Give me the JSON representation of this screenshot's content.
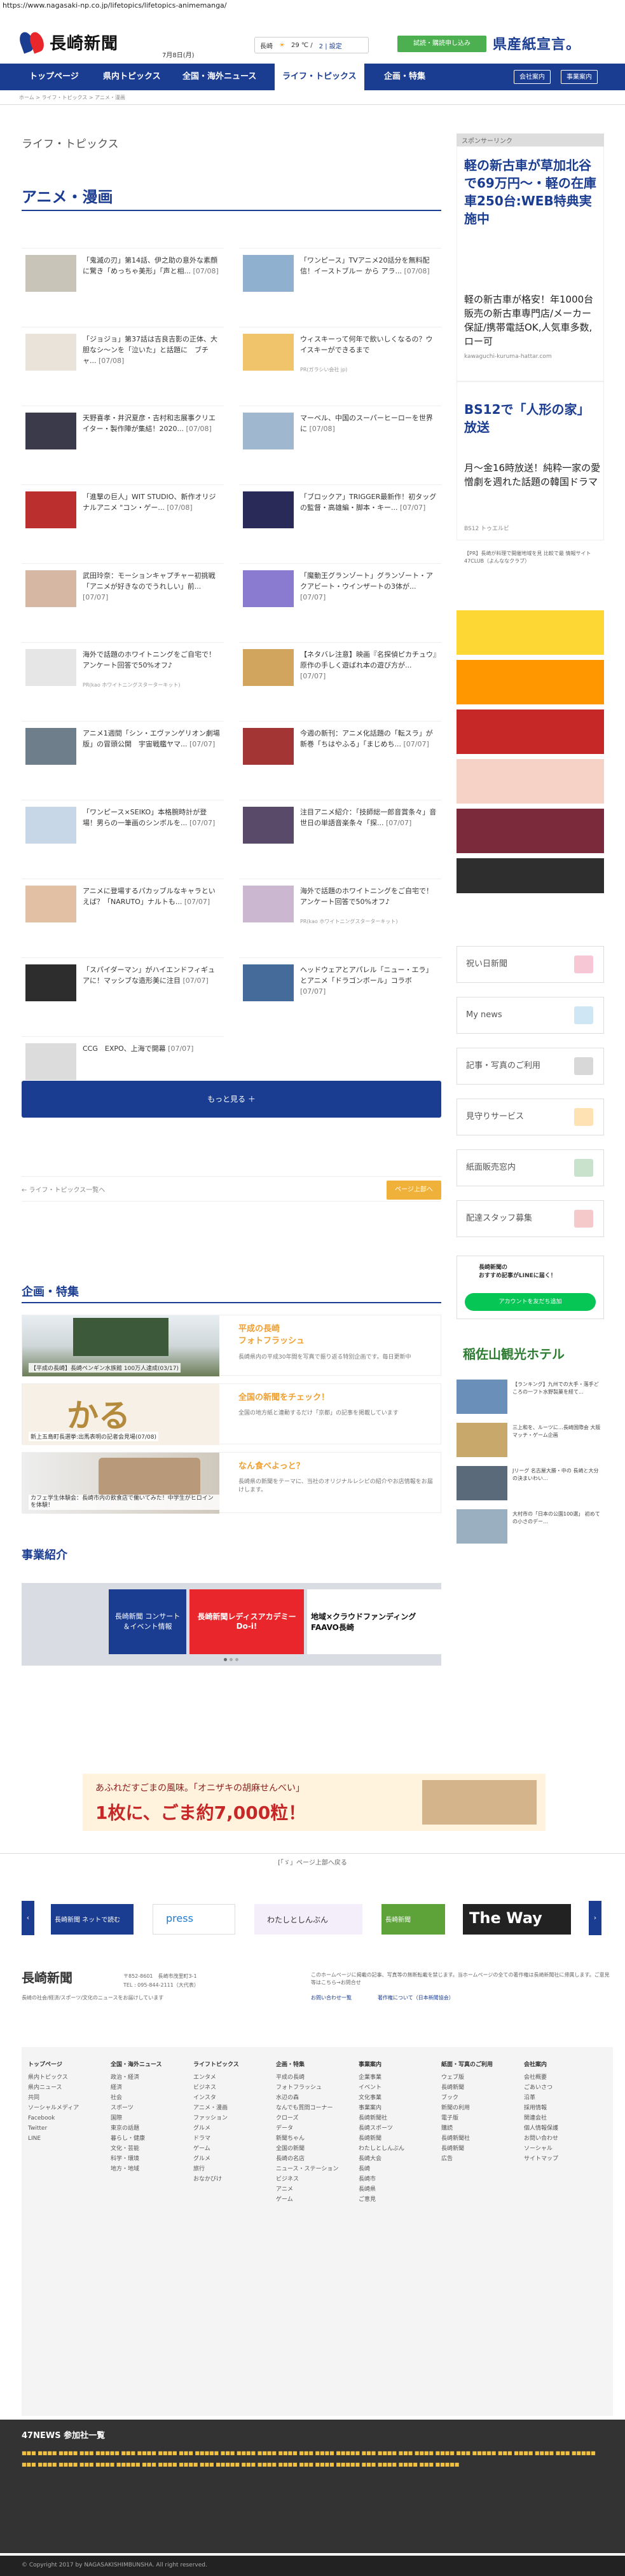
{
  "url": "https://www.nagasaki-np.co.jp/lifetopics/lifetopics-animemanga/",
  "header": {
    "logo_text": "長崎新聞",
    "date": "7月8日(月)",
    "weather_city": "長崎",
    "weather_temp": "29 ℃ /",
    "weather_link": "2 | 設定",
    "trial_button": "試読・購読申し込み",
    "kenryoushi": "県産紙宣言。"
  },
  "nav": {
    "items": [
      "トップページ",
      "県内トピックス",
      "全国・海外ニュース",
      "ライフ・トピックス",
      "企画・特集"
    ],
    "active": "ライフ・トピックス",
    "right": [
      "会社案内",
      "事業案内"
    ]
  },
  "breadcrumb": "ホーム  >  ライフ・トピックス  >  アニメ・漫画",
  "section_label": "ライフ・トピックス",
  "page_title": "アニメ・漫画",
  "cards": [
    {
      "title": "「鬼滅の刃」第14話、伊之助の意外な素顔に驚き「めっちゃ美形」「声と相...",
      "date": "[07/08]"
    },
    {
      "title": "「ワンピース」TVアニメ20話分を無料配信！イーストブルー から アラ...",
      "date": "[07/08]"
    },
    {
      "title": "「ジョジョ」第37話は吉良吉影の正体、大胆なシ～ンを「泣いた」と話題に　ブチャ...",
      "date": "[07/08]"
    },
    {
      "title": "ウィスキーって何年で飲いしくなるの？ウイスキーができるまで",
      "date": ""
    },
    {
      "title": "天野喜孝・井沢夏彦・吉村和志展事クリエイター・製作陣が集結！2020...",
      "date": "[07/08]"
    },
    {
      "title": "マーベル、中国のスーパーヒーローを世界に",
      "date": "[07/08]"
    },
    {
      "title": "「進撃の巨人」WIT STUDIO、新作オリジナルアニメ \"コン・ゲー...",
      "date": "[07/08]"
    },
    {
      "title": "「ブロックア」TRIGGER最新作！初タッグの監督・高雄編・脚本・キー...",
      "date": "[07/07]"
    },
    {
      "title": "武田玲奈：モーションキャプチャー初挑戦「アニメが好きなのでうれしい」前...",
      "date": "[07/07]"
    },
    {
      "title": "「魔動王グランゾート」グランゾート・アクアビート・ウインザートの3体が...",
      "date": "[07/07]"
    },
    {
      "title": "海外で話題のホワイトニングをご自宅で！アンケート回答で50%オフ♪",
      "date": ""
    },
    {
      "title": "【ネタバレ注意】映画『名探偵ピカチュウ』原作の手しく遊ばれ本の遊び方が...",
      "date": "[07/07]"
    },
    {
      "title": "アニメ1週間「シン・エヴァンゲリオン劇場版」の冒頭公開　宇宙戦艦ヤマ...",
      "date": "[07/07]"
    },
    {
      "title": "今週の新刊：アニメ化話題の「転スラ」が新巻「ちはやふる」「まじめち...",
      "date": "[07/07]"
    },
    {
      "title": "「ワンピース×SEIKO」本格腕時計が登場！男らの一筆画のシンボルを...",
      "date": "[07/07]"
    },
    {
      "title": "注目アニメ紹介：「技師総一郎音賞条々」音世日の単語音楽条々「探...",
      "date": "[07/07]"
    },
    {
      "title": "アニメに登場するパカッブルなキャラといえば？「NARUTO」ナルトも...",
      "date": "[07/07]"
    },
    {
      "title": "海外で話題のホワイトニングをご自宅で！アンケート回答で50%オフ♪",
      "date": ""
    },
    {
      "title": "「スパイダーマン」がハイエンドフィギュアに！マッシブな造形美に注目",
      "date": "[07/07]"
    },
    {
      "title": "ヘッドウェアとアパレル「ニュー・エラ」とアニメ「ドラゴンボール」コラボ",
      "date": "[07/07]"
    },
    {
      "title": "CCG　EXPO、上海で開幕",
      "date": "[07/07]"
    }
  ],
  "ad_footnotes": [
    "PR(kao ホワイトニングスターターキット)",
    "PR(ガラシい会社 jp)",
    "PR(kao ホワイトニングスターターキット)"
  ],
  "more_button": "もっと見る ＋",
  "pager": {
    "back": "←  ライフ・トピックス一覧へ",
    "top": "ページ上部へ"
  },
  "features_title": "企画・特集",
  "features": [
    {
      "title": "平成の長崎\nフォトフラッシュ",
      "desc": "長崎県内の平成30年間を写真で振り返る特別企画です。毎日更新中",
      "caption": "【平成の長崎】長崎ペンギン水族館 100万人達成(03/17)"
    },
    {
      "title": "全国の新聞をチェック！",
      "desc": "全国の地方紙と連動するだけ「京都」の記事を掲載しています",
      "caption": "新上五島町長選挙:出馬表明の記者会見場(07/08)"
    },
    {
      "title": "なん食べよっと？",
      "desc": "長崎県の新聞をテーマに、当社のオリジナルレシピの紹介やお店情報をお届けします。",
      "caption": "カフェ学生体験会：長崎市内の飲食店で働いてみた！中学生がヒロインを体験！"
    }
  ],
  "jigyo_title": "事業紹介",
  "jigyo": [
    "長崎新聞 コンサート＆イベント情報",
    "長崎新聞レディスアカデミー Do-i!",
    "地域×クラウドファンディング FAAVO長崎"
  ],
  "sidebar": {
    "sponsor_label": "スポンサーリンク",
    "ad1_title": "軽の新古車が草加北谷で69万円〜・軽の在庫車250台:WEB特典実施中",
    "ad1_desc": "軽の新古車が格安！年1000台販売の新古車専門店/メーカー保証/携帯電話OK,人気車多数,ロー可",
    "ad1_url": "kawaguchi-kuruma-hattar.com",
    "ad2_title": "BS12で「人形の家」放送",
    "ad2_desc": "月〜金16時放送！純粋一家の愛憎劇を週れた話題の韓国ドラマ",
    "ad2_url": "BS12 トゥエルビ",
    "mini_news": "【PR】長崎が料理で開催地域を見 比較で最 情報サイト 47CLUB（よんななクラブ）",
    "links": [
      "祝い日新聞",
      "My news",
      "記事・写真のご利用",
      "見守りサービス",
      "紙面販売窓内",
      "配達スタッフ募集"
    ],
    "line_title": "長崎新聞の\nおすすめ記事がLINEに届く！",
    "line_btn": "アカウントを友だち追加",
    "hotel": "稲佐山観光ホテル",
    "side_news": [
      "【ランキング】九州での大手・落手どころの一フト水野製菓を経て...",
      "三上和を、ルーツに…長崎国際会 大阪マッチ・ゲーム企画",
      "Jリーグ 名古屋大勝・中の 長崎と大分の決まいわい...",
      "大村市の「日本の公園100選」 初めての小さのデー..."
    ]
  },
  "bottom_ad": {
    "line1": "あふれだすごまの風味。「オニザキの胡麻せんべい」",
    "line2": "1枚に、ごま約7,000粒！"
  },
  "pr_bar": "[「ゞ」ページ上部へ戻る",
  "carousel": [
    "長崎新聞 ネットで読む",
    "press",
    "わたしとしんぶん",
    "長崎新聞",
    "The Way"
  ],
  "footer": {
    "logo": "長崎新聞",
    "tagline": "長崎の社会/経済/スポーツ/文化のニュースをお届けしています",
    "address": "〒852-8601　長崎市茂里町3-1",
    "tel": "TEL : 095-844-2111（大代表）",
    "notice": "このホームページに掲載の記事、写真等の無断転載を禁じます。当ホームページの全ての著作権は長崎新聞社に帰属します。ご意見等はこちら→お問合せ",
    "links2": [
      "お問い合わせ一覧",
      "著作権について（日本新聞協会）"
    ]
  },
  "footer_cols": [
    {
      "head": "トップページ",
      "items": [
        "県内トピックス",
        "県内ニュース",
        "共同",
        "ソーシャルメディア",
        "Facebook",
        "Twitter",
        "LINE"
      ]
    },
    {
      "head": "全国・海外ニュース",
      "items": [
        "政治・経済",
        "経済",
        "社会",
        "スポーツ",
        "国際",
        "東京の話題",
        "暮らし・健康",
        "文化・芸能",
        "科学・環境",
        "地方・地域"
      ]
    },
    {
      "head": "ライフトピックス",
      "items": [
        "エンタメ",
        "ビジネス",
        "インスタ",
        "アニメ・漫画",
        "ファッション",
        "グルメ",
        "ドラマ",
        "ゲーム",
        "グルメ",
        "旅行",
        "おなかびけ"
      ]
    },
    {
      "head": "企画・特集",
      "items": [
        "平成の長崎",
        "フォトフラッシュ",
        "水辺の森",
        "なんでも質問コーナー",
        "クローズ",
        "データ",
        "新聞ちゃん",
        "全国の新聞",
        "長崎の名店",
        "ニュース・ステーション",
        "ビジネス",
        "アニメ",
        "ゲーム"
      ]
    },
    {
      "head": "事業案内",
      "items": [
        "企業事業",
        "イベント",
        "文化事業",
        "事業案内",
        "長崎新聞社",
        "長崎スポーツ",
        "長崎新聞",
        "わたしとしんぶん",
        "長崎大会",
        "長崎",
        "長崎市",
        "長崎県",
        "ご意見"
      ]
    },
    {
      "head": "紙面・写真のご利用",
      "items": [
        "ウェブ版",
        "長崎新聞",
        "ブック",
        "新聞の利用",
        "電子版",
        "購読",
        "長崎新聞社",
        "長崎新聞",
        "広告"
      ]
    },
    {
      "head": "会社案内",
      "items": [
        "会社概要",
        "ごあいさつ",
        "沿革",
        "採用情報",
        "関連会社",
        "個人情報保護",
        "お問い合わせ",
        "ソーシャル",
        "サイトマップ"
      ]
    }
  ],
  "news47": {
    "title": "47NEWS 参加社一覧"
  },
  "copyright": "© Copyright 2017 by NAGASAKISHIMBUNSHA. All right reserved."
}
